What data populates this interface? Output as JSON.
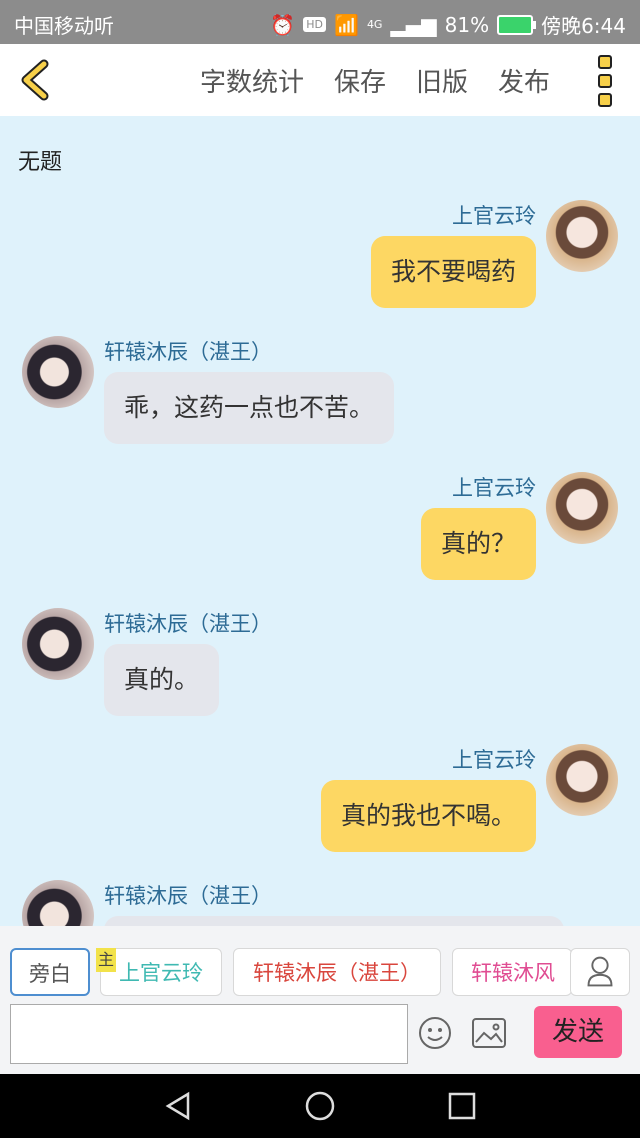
{
  "status_bar": {
    "carrier": "中国移动听",
    "hd": "HD",
    "network": "4G",
    "battery": "81%",
    "time": "傍晚6:44"
  },
  "toolbar": {
    "word_count": "字数统计",
    "save": "保存",
    "old_version": "旧版",
    "publish": "发布"
  },
  "story_title": "无题",
  "messages": [
    {
      "speaker": "上官云玲",
      "text": "我不要喝药",
      "side": "right"
    },
    {
      "speaker": "轩辕沐辰（湛王）",
      "text": "乖，这药一点也不苦。",
      "side": "left"
    },
    {
      "speaker": "上官云玲",
      "text": "真的？",
      "side": "right"
    },
    {
      "speaker": "轩辕沐辰（湛王）",
      "text": "真的。",
      "side": "left"
    },
    {
      "speaker": "上官云玲",
      "text": "真的我也不喝。",
      "side": "right"
    },
    {
      "speaker": "轩辕沐辰（湛王）",
      "text": "",
      "side": "left"
    }
  ],
  "characters": {
    "narration": "旁白",
    "main_tag": "主",
    "c1": "上官云玲",
    "c2": "轩辕沐辰（湛王）",
    "c3": "轩辕沐风（"
  },
  "input": {
    "placeholder": "",
    "send": "发送"
  },
  "colors": {
    "chat_bg": "#dff2fb",
    "right_bubble": "#fdd763",
    "left_bubble": "#e4e6ec",
    "send_button": "#f95f8f"
  }
}
